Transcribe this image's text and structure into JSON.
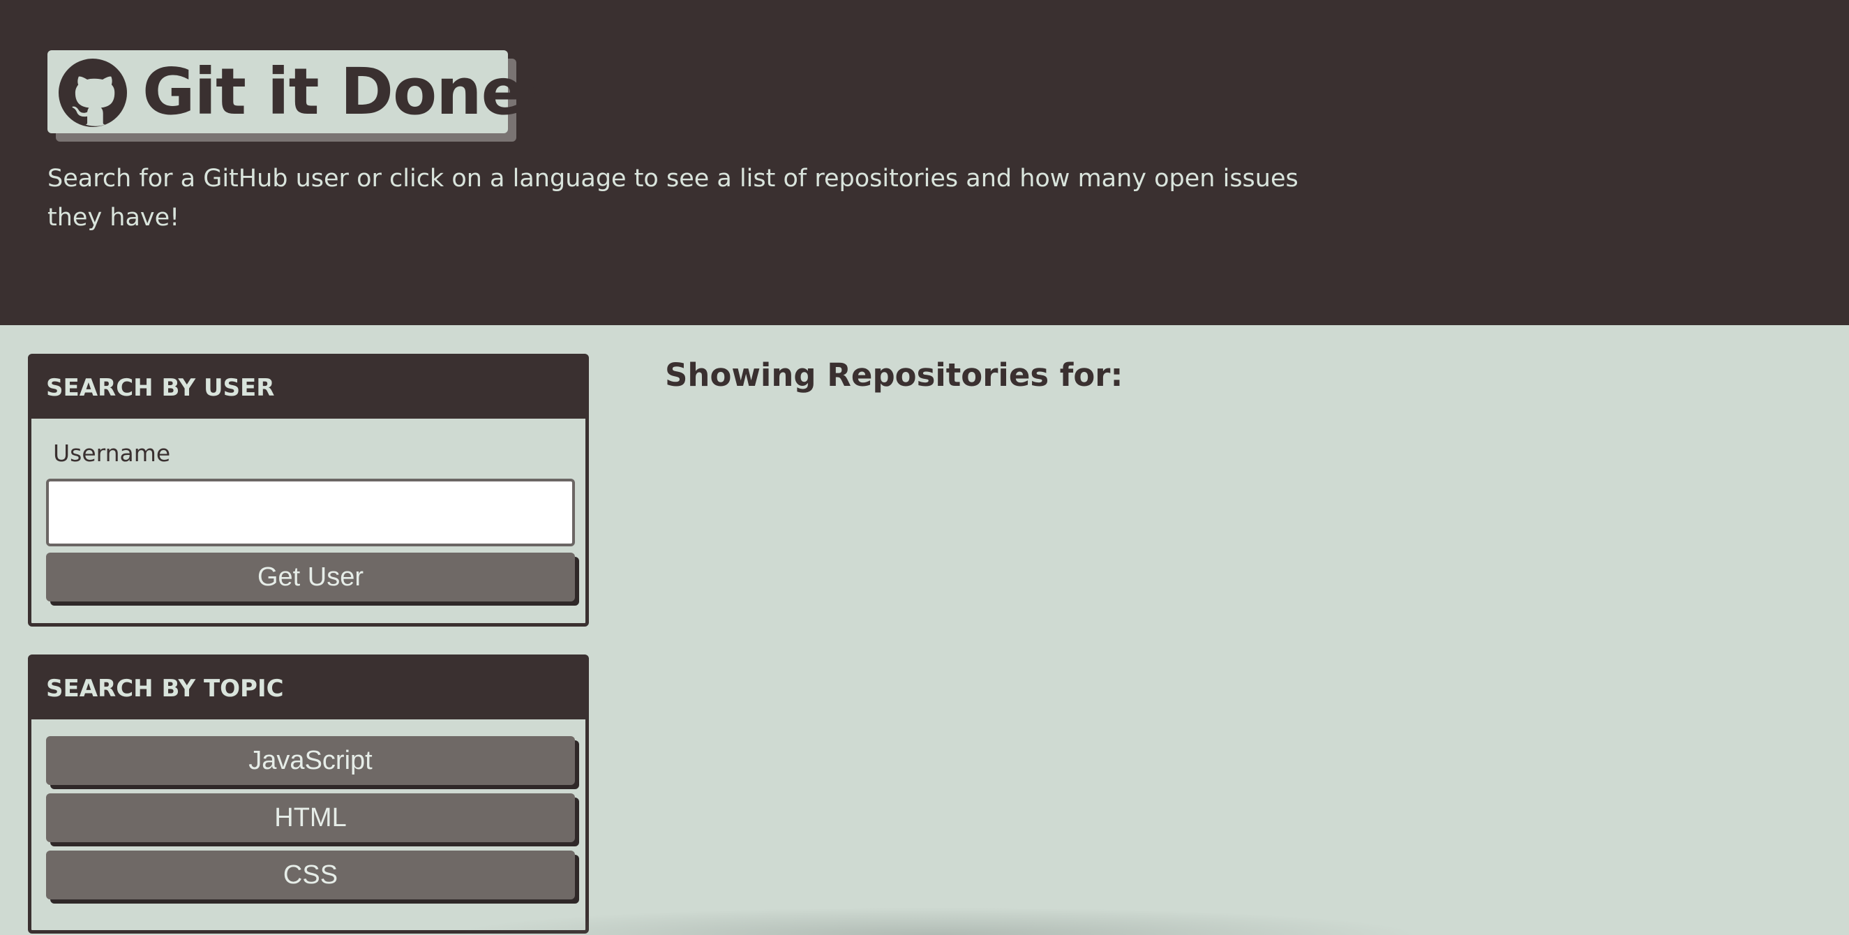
{
  "header": {
    "title": "Git it Done!",
    "subtitle": "Search for a GitHub user or click on a language to see a list of repositories and how many open issues they have!",
    "logo_icon": "github-octocat-icon"
  },
  "user_search": {
    "heading": "SEARCH BY USER",
    "field_label": "Username",
    "input_value": "",
    "button_label": "Get User"
  },
  "topic_search": {
    "heading": "SEARCH BY TOPIC",
    "languages": [
      "JavaScript",
      "HTML",
      "CSS"
    ]
  },
  "repos": {
    "heading": "Showing Repositories for:"
  },
  "colors": {
    "dark": "#3a3030",
    "background": "#cfdad2",
    "button": "#6f6966",
    "light_text": "#d9e4dc"
  }
}
